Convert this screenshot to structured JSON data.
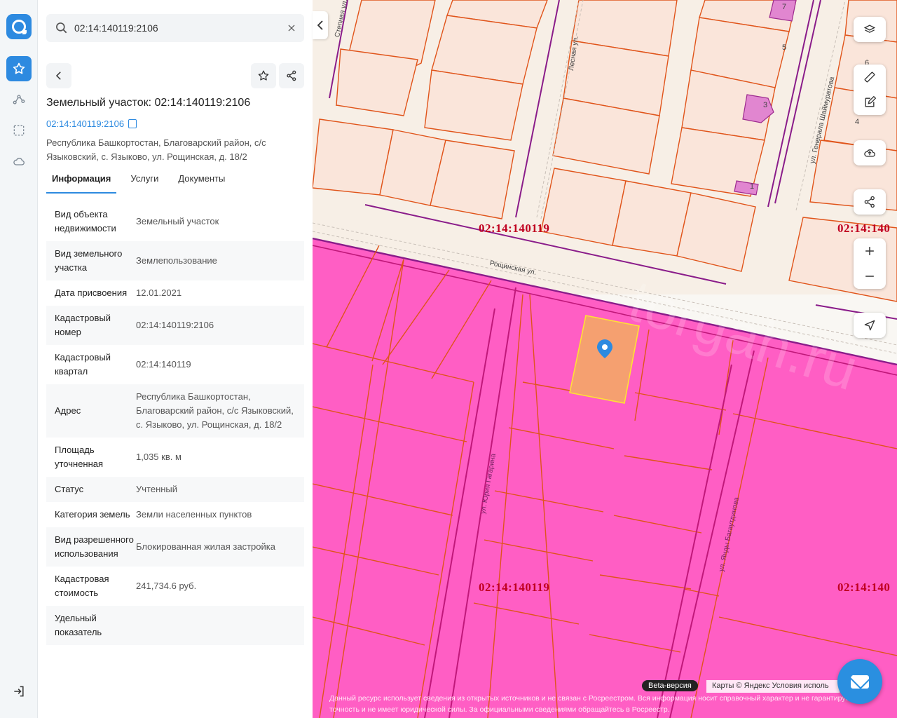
{
  "search": {
    "value": "02:14:140119:2106"
  },
  "title": "Земельный участок: 02:14:140119:2106",
  "cadastral_link": "02:14:140119:2106",
  "address_full": "Республика Башкортостан, Благоварский район, с/с Языковский, с. Языково, ул. Рощинская, д. 18/2",
  "tabs": [
    "Информация",
    "Услуги",
    "Документы"
  ],
  "info_rows": [
    {
      "k": "Вид объекта недвижимости",
      "v": "Земельный участок"
    },
    {
      "k": "Вид земельного участка",
      "v": "Землепользование"
    },
    {
      "k": "Дата присвоения",
      "v": "12.01.2021"
    },
    {
      "k": "Кадастровый номер",
      "v": "02:14:140119:2106"
    },
    {
      "k": "Кадастровый квартал",
      "v": "02:14:140119"
    },
    {
      "k": "Адрес",
      "v": "Республика Башкортостан, Благоварский район, с/с Языковский, с. Языково, ул. Рощинская, д. 18/2"
    },
    {
      "k": "Площадь уточненная",
      "v": "1,035 кв. м"
    },
    {
      "k": "Статус",
      "v": "Учтенный"
    },
    {
      "k": "Категория земель",
      "v": "Земли населенных пунктов"
    },
    {
      "k": "Вид разрешенного использования",
      "v": "Блокированная жилая застройка"
    },
    {
      "k": "Кадастровая стоимость",
      "v": "241,734.6 руб."
    },
    {
      "k": "Удельный показатель",
      "v": ""
    }
  ],
  "map": {
    "quarter_labels": [
      "02:14:140119",
      "02:14:140119",
      "02:14:140",
      "02:14:140"
    ],
    "streets": [
      "Степная ул.",
      "Лесная ул.",
      "ул. Генерала Шаймуратова",
      "Рощинская ул.",
      "ул. Юрия Гагарина",
      "ул. Янды Багаутдинова"
    ],
    "house_numbers": [
      "7",
      "5",
      "3",
      "1",
      "6",
      "4"
    ],
    "watermark": "torgah.ru",
    "beta": "Beta-версия",
    "attribution": "Карты © Яндекс   Условия исполь",
    "disclaimer": "Данный ресурс использует сведения из открытых источников и не связан с Росреестром. Вся информация носит справочный характер и не гарантирует точность и не имеет юридической силы. За официальными сведениями обращайтесь в Росреестр."
  },
  "colors": {
    "accent": "#2d8ae0",
    "zone": "#ff5ec4",
    "parcel_line": "#e0541a",
    "selected": "#f5a070"
  }
}
